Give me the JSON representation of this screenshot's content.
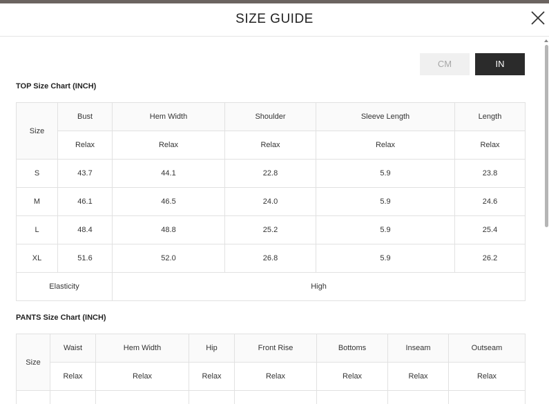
{
  "title": "SIZE GUIDE",
  "units": {
    "cm": "CM",
    "in": "IN",
    "selected": "IN"
  },
  "top": {
    "title": "TOP Size Chart (INCH)",
    "size_label": "Size",
    "columns": [
      "Bust",
      "Hem Width",
      "Shoulder",
      "Sleeve Length",
      "Length"
    ],
    "fit_row": [
      "Relax",
      "Relax",
      "Relax",
      "Relax",
      "Relax"
    ],
    "rows": [
      {
        "size": "S",
        "values": [
          "43.7",
          "44.1",
          "22.8",
          "5.9",
          "23.8"
        ]
      },
      {
        "size": "M",
        "values": [
          "46.1",
          "46.5",
          "24.0",
          "5.9",
          "24.6"
        ]
      },
      {
        "size": "L",
        "values": [
          "48.4",
          "48.8",
          "25.2",
          "5.9",
          "25.4"
        ]
      },
      {
        "size": "XL",
        "values": [
          "51.6",
          "52.0",
          "26.8",
          "5.9",
          "26.2"
        ]
      }
    ],
    "elasticity_label": "Elasticity",
    "elasticity_value": "High"
  },
  "pants": {
    "title": "PANTS Size Chart (INCH)",
    "size_label": "Size",
    "columns": [
      "Waist",
      "Hem Width",
      "Hip",
      "Front Rise",
      "Bottoms",
      "Inseam",
      "Outseam"
    ],
    "fit_row": [
      "Relax",
      "Relax",
      "Relax",
      "Relax",
      "Relax",
      "Relax",
      "Relax"
    ]
  }
}
